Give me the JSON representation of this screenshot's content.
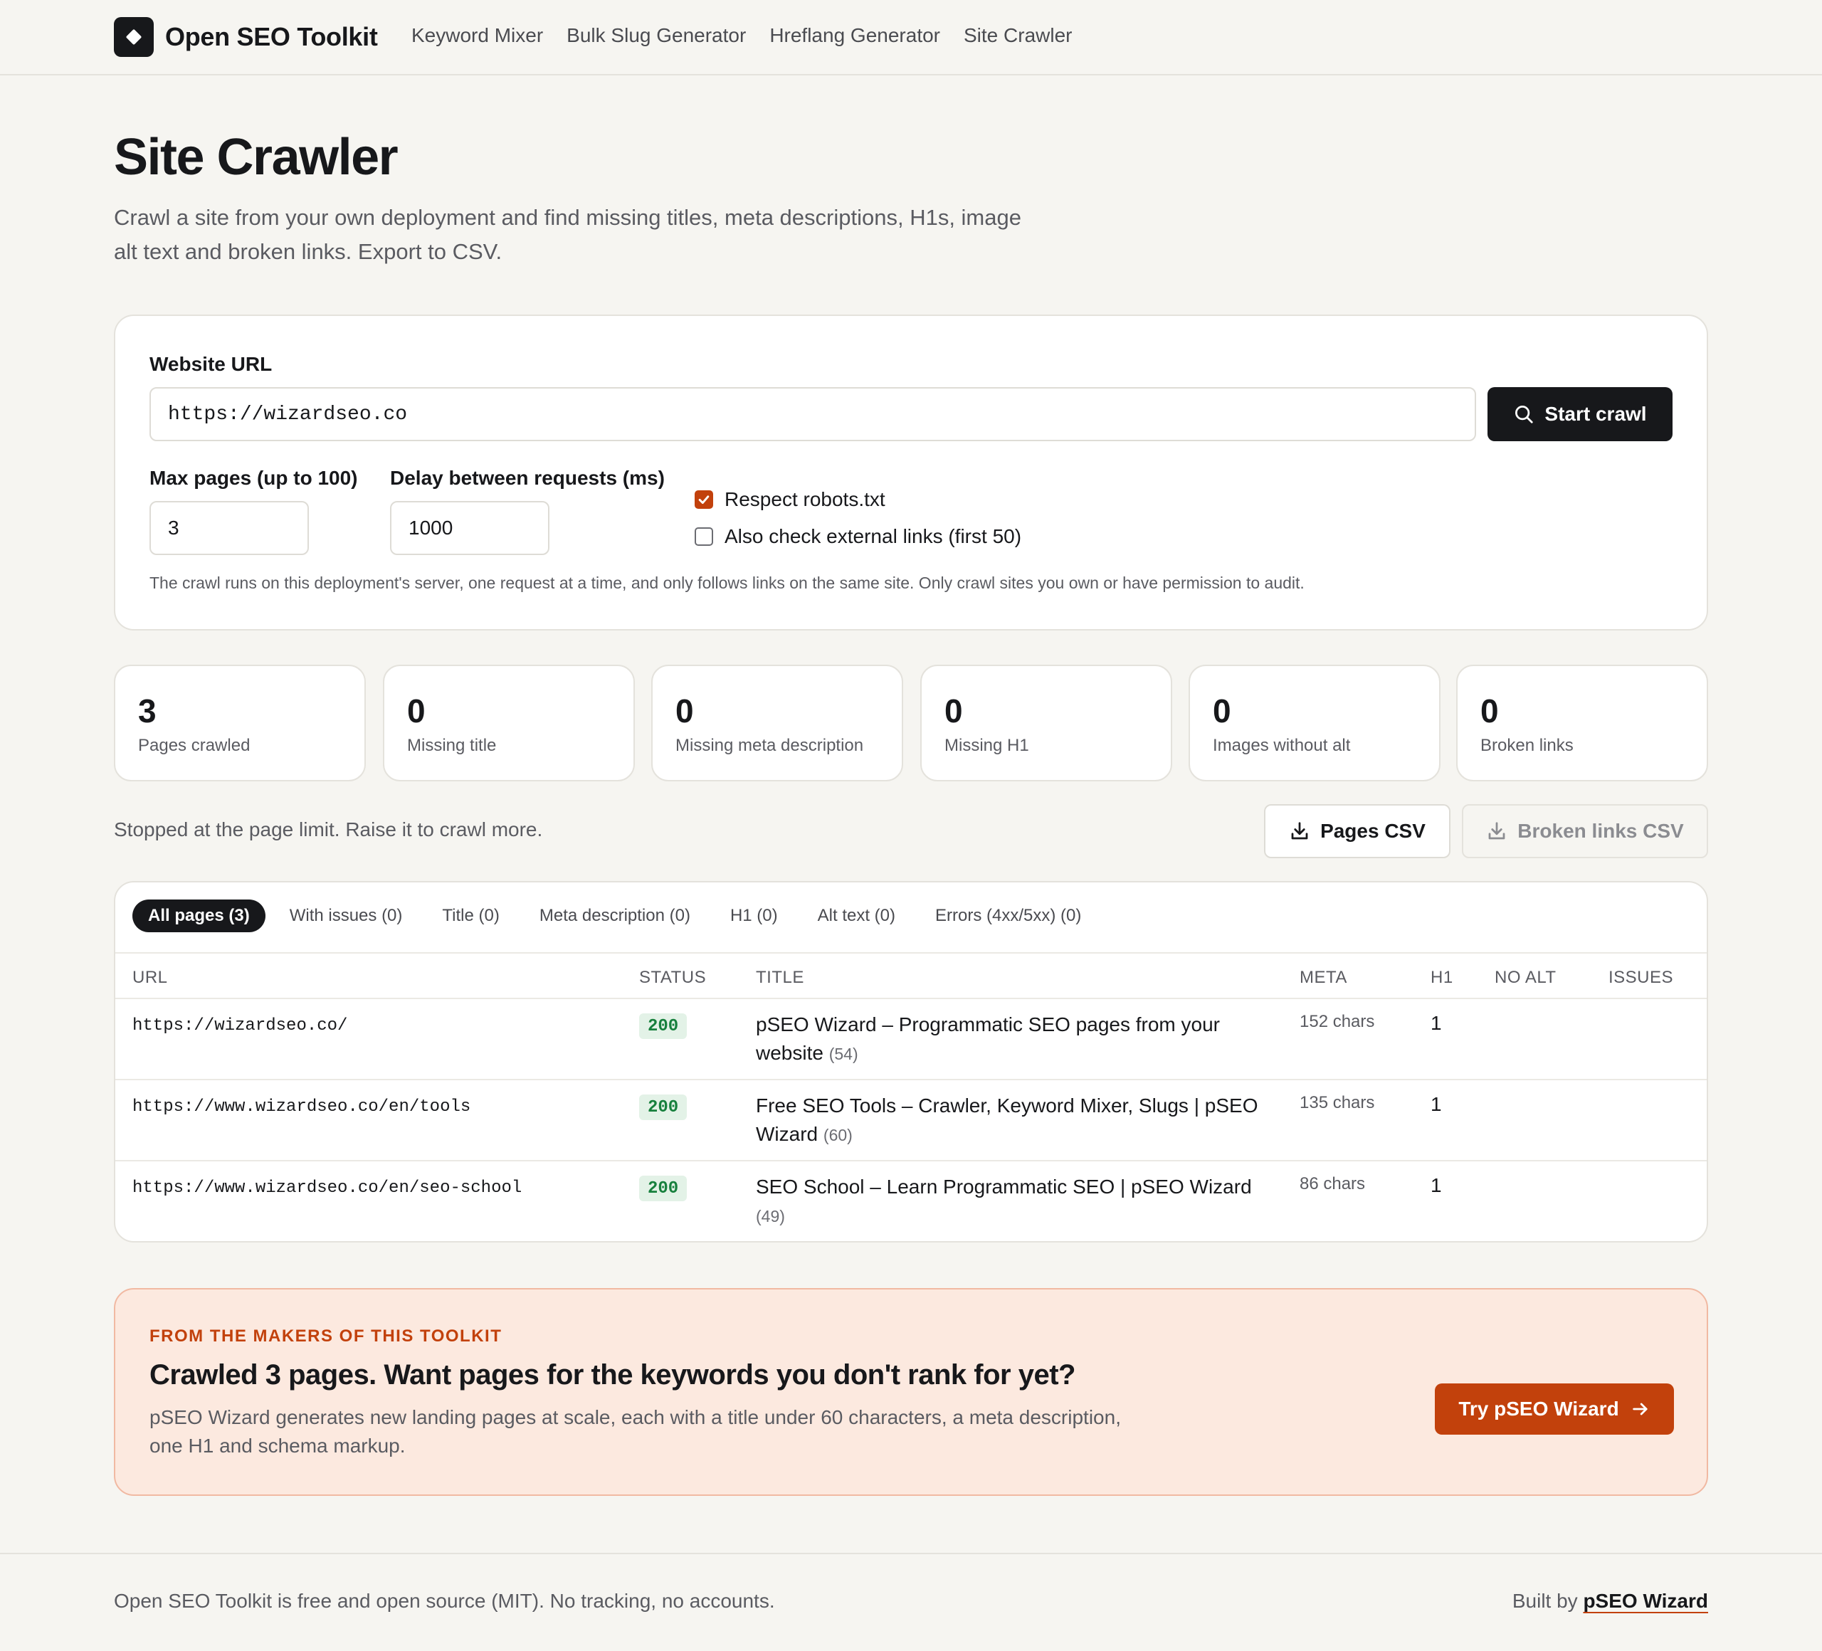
{
  "brand": {
    "name": "Open SEO Toolkit",
    "logo_icon": "diamond-icon"
  },
  "nav": [
    "Keyword Mixer",
    "Bulk Slug Generator",
    "Hreflang Generator",
    "Site Crawler"
  ],
  "page": {
    "title": "Site Crawler",
    "description": "Crawl a site from your own deployment and find missing titles, meta descriptions, H1s, image alt text and broken links. Export to CSV."
  },
  "form": {
    "url_label": "Website URL",
    "url_value": "https://wizardseo.co",
    "start_label": "Start crawl",
    "max_pages_label": "Max pages (up to 100)",
    "max_pages_value": "3",
    "delay_label": "Delay between requests (ms)",
    "delay_value": "1000",
    "robots_label": "Respect robots.txt",
    "robots_checked": true,
    "external_label": "Also check external links (first 50)",
    "external_checked": false,
    "note": "The crawl runs on this deployment's server, one request at a time, and only follows links on the same site. Only crawl sites you own or have permission to audit."
  },
  "stats": [
    {
      "value": "3",
      "label": "Pages crawled"
    },
    {
      "value": "0",
      "label": "Missing title"
    },
    {
      "value": "0",
      "label": "Missing meta description"
    },
    {
      "value": "0",
      "label": "Missing H1"
    },
    {
      "value": "0",
      "label": "Images without alt"
    },
    {
      "value": "0",
      "label": "Broken links"
    }
  ],
  "status_note": "Stopped at the page limit. Raise it to crawl more.",
  "exports": {
    "pages_csv": "Pages CSV",
    "broken_csv": "Broken links CSV"
  },
  "tabs": [
    "All pages (3)",
    "With issues (0)",
    "Title (0)",
    "Meta description (0)",
    "H1 (0)",
    "Alt text (0)",
    "Errors (4xx/5xx) (0)"
  ],
  "columns": [
    "URL",
    "STATUS",
    "TITLE",
    "META",
    "H1",
    "NO ALT",
    "ISSUES"
  ],
  "rows": [
    {
      "url": "https://wizardseo.co/",
      "status": "200",
      "title": "pSEO Wizard – Programmatic SEO pages from your website",
      "title_len": "(54)",
      "meta": "152 chars",
      "h1": "1"
    },
    {
      "url": "https://www.wizardseo.co/en/tools",
      "status": "200",
      "title": "Free SEO Tools – Crawler, Keyword Mixer, Slugs | pSEO Wizard",
      "title_len": "(60)",
      "meta": "135 chars",
      "h1": "1"
    },
    {
      "url": "https://www.wizardseo.co/en/seo-school",
      "status": "200",
      "title": "SEO School – Learn Programmatic SEO | pSEO Wizard",
      "title_len": "(49)",
      "meta": "86 chars",
      "h1": "1"
    }
  ],
  "promo": {
    "kicker": "FROM THE MAKERS OF THIS TOOLKIT",
    "headline": "Crawled 3 pages. Want pages for the keywords you don't rank for yet?",
    "body": "pSEO Wizard generates new landing pages at scale, each with a title under 60 characters, a meta description, one H1 and schema markup.",
    "cta": "Try pSEO Wizard"
  },
  "footer": {
    "left": "Open SEO Toolkit is free and open source (MIT). No tracking, no accounts.",
    "built_by": "Built by",
    "built_link": "pSEO Wizard"
  },
  "colors": {
    "accent": "#c2410c",
    "dark": "#17181b",
    "background": "#f6f5f1",
    "success": "#17803d"
  }
}
